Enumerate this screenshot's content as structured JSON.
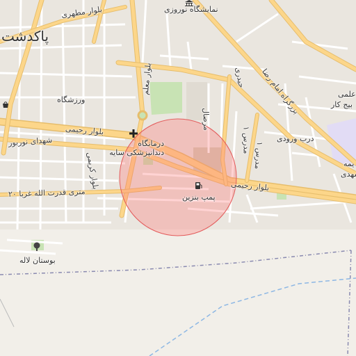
{
  "map": {
    "colors": {
      "background": "#f2efe9",
      "major_road": "#fcd68a",
      "major_road_casing": "#e6bd6c",
      "minor_road": "#ffffff",
      "park": "#c8e3b4",
      "building_area": "#e0dbd2",
      "marker_circle_fill": "rgba(255,110,110,0.30)",
      "marker_circle_stroke": "#e35b5b",
      "boundary": "#8a8ab0",
      "water_dash": "#8db7e4"
    },
    "labels": {
      "city": "پاکدشت",
      "blvd_motahari": "بلوار مطهری",
      "museum": "نمایشگاه نوروزی",
      "blvd_moallem": "بلوار معلم",
      "gym": "ورزشگاه",
      "blvd_rahimi_w": "بلوار رحیمی",
      "shohada": "شهدای نوربور",
      "clinic": "درمانگاه دندانپزشکی سایه",
      "karimi": "بلوار کریمی",
      "ghodrat": "۲۰ متری قدرت الله غربا",
      "park": "بوستان لاله",
      "fuel": "پمپ بنزین",
      "blvd_rahimi_e": "بلوار رحیمی",
      "imam_reza": "بزرگراه امام رضا",
      "heidari": "حیدری",
      "marsal": "مرصال",
      "madares": "مدرس ۱",
      "madares2": "مدرس ۱",
      "darb": "درب ورودی",
      "right_top1": "علمی",
      "right_top2": "بیج کار",
      "right_mid1": "یمه",
      "right_mid2": "شهدی"
    },
    "icons": {
      "museum": "museum-icon",
      "hospital": "hospital-cross-icon",
      "fuel": "fuel-icon",
      "tree": "tree-icon",
      "shopping": "shopping-icon"
    }
  }
}
